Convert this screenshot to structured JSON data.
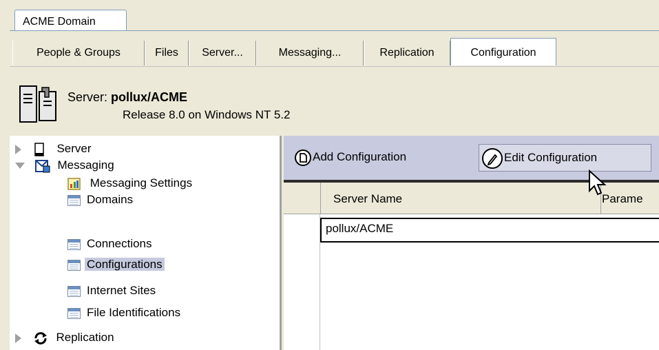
{
  "domain_tab": "ACME Domain",
  "tabs": [
    {
      "label": "People & Groups"
    },
    {
      "label": "Files"
    },
    {
      "label": "Server..."
    },
    {
      "label": "Messaging..."
    },
    {
      "label": "Replication"
    },
    {
      "label": "Configuration"
    }
  ],
  "server": {
    "label": "Server:",
    "name": "pollux/ACME",
    "release": "Release 8.0 on Windows NT 5.2"
  },
  "tree": {
    "server": "Server",
    "messaging": "Messaging",
    "items": [
      {
        "label": "Messaging Settings"
      },
      {
        "label": "Domains"
      },
      {
        "label": "Connections"
      },
      {
        "label": "Configurations"
      },
      {
        "label": "Internet Sites"
      },
      {
        "label": "File Identifications"
      }
    ],
    "replication": "Replication"
  },
  "toolbar": {
    "add_label": "Add Configuration",
    "edit_label": "Edit Configuration"
  },
  "grid": {
    "columns": [
      "Server Name",
      "Parame"
    ],
    "rows": [
      [
        "pollux/ACME"
      ]
    ]
  },
  "colors": {
    "toolbar_bg": "#c8cadf",
    "selection": "#c5c9dd",
    "chrome": "#ece9d8"
  }
}
